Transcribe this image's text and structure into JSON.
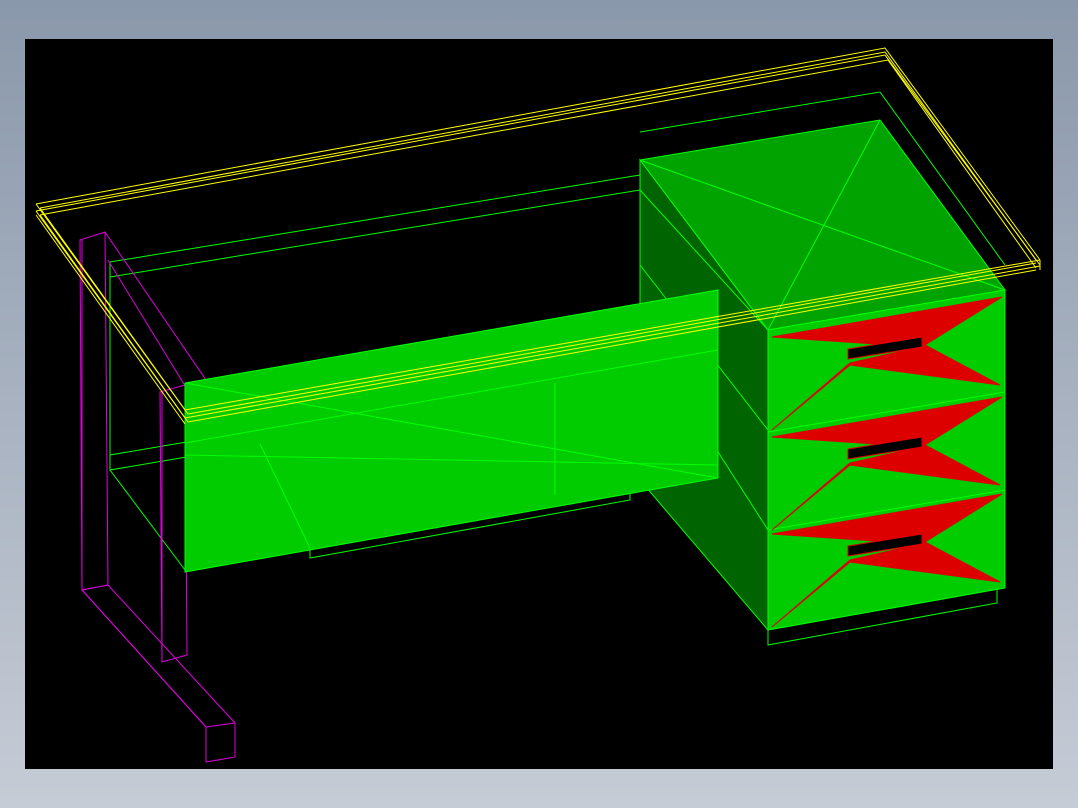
{
  "viewport": {
    "background_color": "#000000",
    "frame_gradient_top": "#8a98ab",
    "frame_gradient_bottom": "#c6ccd6"
  },
  "colors": {
    "desktop_top_outline": "#ffff00",
    "frame_outline": "#00ff00",
    "panel_fill_light": "#00cc00",
    "panel_fill_top": "#00a300",
    "panel_fill_dark": "#006400",
    "leg_outline": "#e000e0",
    "drawer_face_red": "#dd0000",
    "drawer_handle": "#000000"
  },
  "model": {
    "object": "desk-with-drawer-pedestal",
    "drawer_count": 3,
    "view": "isometric-wireframe-shaded"
  }
}
